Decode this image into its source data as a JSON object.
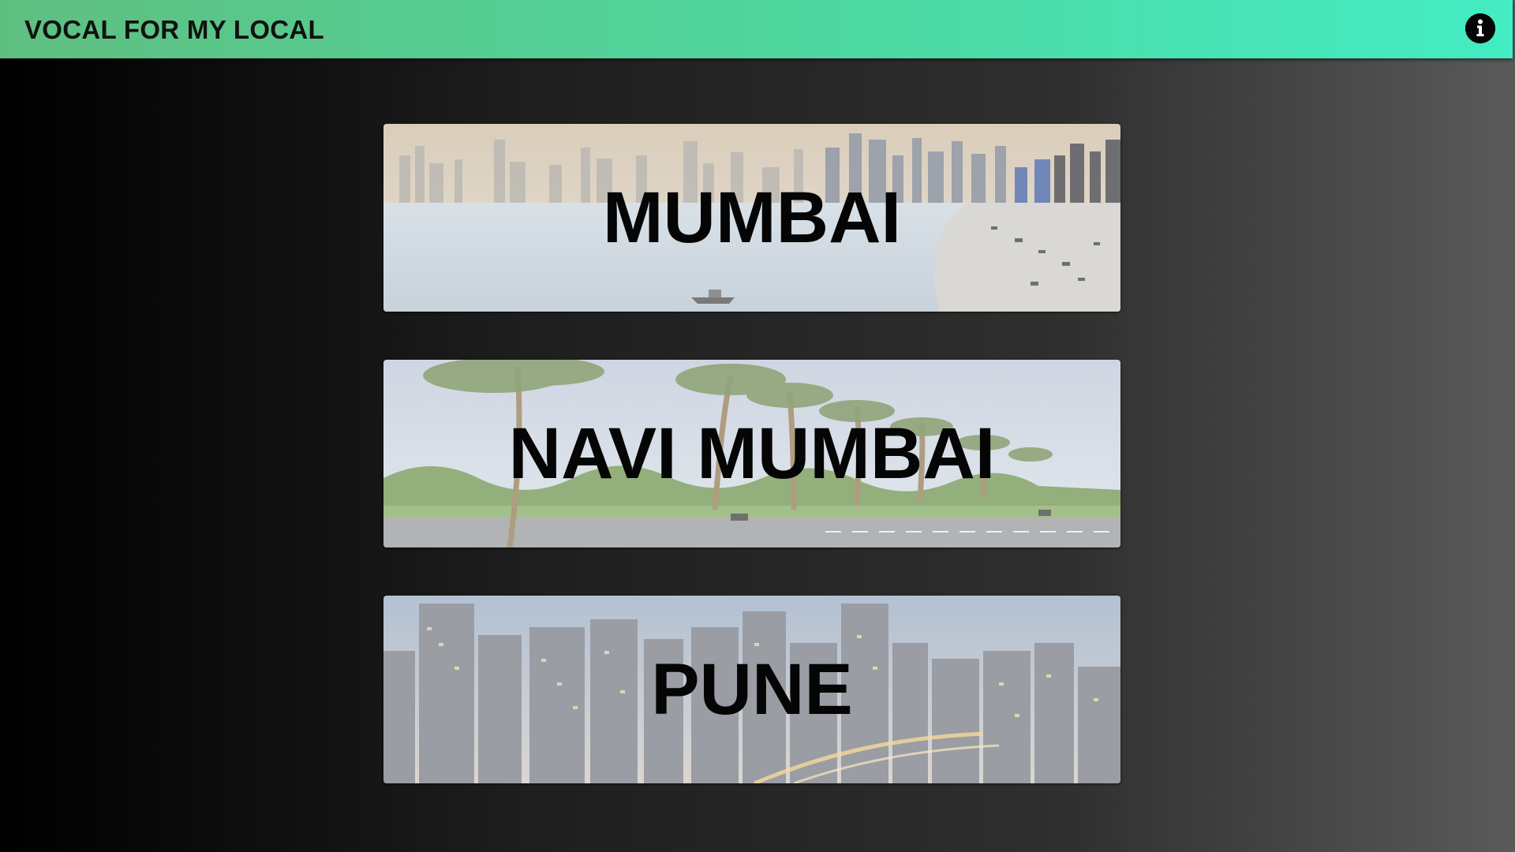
{
  "header": {
    "title": "VOCAL FOR MY LOCAL",
    "info_icon": "info-icon"
  },
  "cities": [
    {
      "name": "MUMBAI",
      "scene": "coastal skyline watercolor"
    },
    {
      "name": "NAVI MUMBAI",
      "scene": "palm-lined road"
    },
    {
      "name": "PUNE",
      "scene": "city skyline at dusk"
    }
  ],
  "colors": {
    "header_start": "#5fbf80",
    "header_end": "#44ecc3",
    "label_text": "#050505"
  }
}
